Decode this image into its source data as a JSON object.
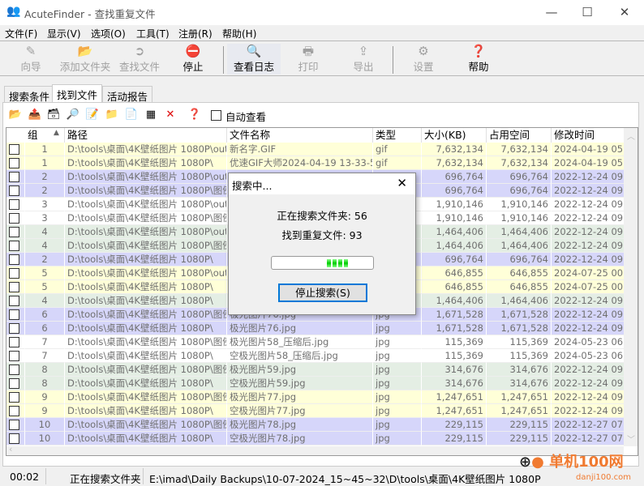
{
  "window": {
    "title": "AcuteFinder - 查找重复文件",
    "minimize": "—",
    "maximize": "☐",
    "close": "✕"
  },
  "menu": [
    "文件(F)",
    "显示(V)",
    "选项(O)",
    "工具(T)",
    "注册(R)",
    "帮助(H)"
  ],
  "toolbar": [
    {
      "label": "向导",
      "icon": "wand-icon",
      "enabled": false
    },
    {
      "label": "添加文件夹",
      "icon": "add-folder-icon",
      "enabled": false
    },
    {
      "label": "查找文件",
      "icon": "search-arrow-icon",
      "enabled": false
    },
    {
      "label": "停止",
      "icon": "stop-icon",
      "enabled": true
    },
    {
      "label": "查看日志",
      "icon": "log-icon",
      "enabled": true
    },
    {
      "label": "打印",
      "icon": "printer-icon",
      "enabled": false
    },
    {
      "label": "导出",
      "icon": "export-icon",
      "enabled": false
    },
    {
      "label": "设置",
      "icon": "settings-icon",
      "enabled": false
    },
    {
      "label": "帮助",
      "icon": "help-icon",
      "enabled": true
    }
  ],
  "tabs": [
    {
      "label": "搜索条件"
    },
    {
      "label": "找到文件",
      "active": true
    },
    {
      "label": "活动报告"
    }
  ],
  "subtoolbar": {
    "icons": [
      "open-folder-icon",
      "folder-up-icon",
      "archive-icon",
      "magnifier-icon",
      "edit-icon",
      "move-folder-icon",
      "copy-file-icon",
      "group-icon",
      "delete-icon",
      "help-icon"
    ],
    "auto_view": "自动查看"
  },
  "columns": [
    "组",
    "路径",
    "文件名称",
    "类型",
    "大小(KB)",
    "占用空间(KB)",
    "修改时间"
  ],
  "colors": {
    "yellow": "#ffffd8",
    "lavender": "#d6d6fa",
    "white": "#ffffff",
    "green": "#e4eee4"
  },
  "rows": [
    {
      "g": "1",
      "path": "D:\\tools\\桌面\\4K壁纸图片 1080P\\out...",
      "name": "新名字.GIF",
      "type": "gif",
      "size": "7,632,134",
      "space": "7,632,134",
      "mtime": "2024-04-19 05:33",
      "color": "yellow"
    },
    {
      "g": "1",
      "path": "D:\\tools\\桌面\\4K壁纸图片 1080P\\",
      "name": "优速GIF大师2024-04-19 13-33-5...",
      "type": "gif",
      "size": "7,632,134",
      "space": "7,632,134",
      "mtime": "2024-04-19 05:33",
      "color": "yellow"
    },
    {
      "g": "2",
      "path": "D:\\tools\\桌面\\4K壁纸图片 1080P\\out...",
      "name": "",
      "type": "",
      "size": "696,764",
      "space": "696,764",
      "mtime": "2022-12-24 09:53",
      "color": "lavender"
    },
    {
      "g": "2",
      "path": "D:\\tools\\桌面\\4K壁纸图片 1080P\\图例\\",
      "name": "",
      "type": "",
      "size": "696,764",
      "space": "696,764",
      "mtime": "2022-12-24 09:53",
      "color": "lavender"
    },
    {
      "g": "3",
      "path": "D:\\tools\\桌面\\4K壁纸图片 1080P\\out...",
      "name": "",
      "type": "",
      "size": "1,910,146",
      "space": "1,910,146",
      "mtime": "2022-12-24 09:53",
      "color": "white"
    },
    {
      "g": "3",
      "path": "D:\\tools\\桌面\\4K壁纸图片 1080P\\图例\\",
      "name": "",
      "type": "",
      "size": "1,910,146",
      "space": "1,910,146",
      "mtime": "2022-12-24 09:53",
      "color": "white"
    },
    {
      "g": "4",
      "path": "D:\\tools\\桌面\\4K壁纸图片 1080P\\out...",
      "name": "",
      "type": "",
      "size": "1,464,406",
      "space": "1,464,406",
      "mtime": "2022-12-24 09:52",
      "color": "green"
    },
    {
      "g": "4",
      "path": "D:\\tools\\桌面\\4K壁纸图片 1080P\\图例\\",
      "name": "",
      "type": "",
      "size": "1,464,406",
      "space": "1,464,406",
      "mtime": "2022-12-24 09:52",
      "color": "green"
    },
    {
      "g": "2",
      "path": "D:\\tools\\桌面\\4K壁纸图片 1080P\\",
      "name": "",
      "type": "",
      "size": "696,764",
      "space": "696,764",
      "mtime": "2022-12-24 09:53",
      "color": "lavender"
    },
    {
      "g": "5",
      "path": "D:\\tools\\桌面\\4K壁纸图片 1080P\\out...",
      "name": "",
      "type": "",
      "size": "646,855",
      "space": "646,855",
      "mtime": "2024-07-25 00:37",
      "color": "yellow"
    },
    {
      "g": "5",
      "path": "D:\\tools\\桌面\\4K壁纸图片 1080P\\",
      "name": "",
      "type": "",
      "size": "646,855",
      "space": "646,855",
      "mtime": "2024-07-25 00:37",
      "color": "yellow"
    },
    {
      "g": "4",
      "path": "D:\\tools\\桌面\\4K壁纸图片 1080P\\",
      "name": "",
      "type": "",
      "size": "1,464,406",
      "space": "1,464,406",
      "mtime": "2022-12-24 09:52",
      "color": "green"
    },
    {
      "g": "6",
      "path": "D:\\tools\\桌面\\4K壁纸图片 1080P\\图例\\",
      "name": "极光图片76.jpg",
      "type": "jpg",
      "size": "1,671,528",
      "space": "1,671,528",
      "mtime": "2022-12-24 09:53",
      "color": "lavender"
    },
    {
      "g": "6",
      "path": "D:\\tools\\桌面\\4K壁纸图片 1080P\\",
      "name": "极光图片76.jpg",
      "type": "jpg",
      "size": "1,671,528",
      "space": "1,671,528",
      "mtime": "2022-12-24 09:53",
      "color": "lavender"
    },
    {
      "g": "7",
      "path": "D:\\tools\\桌面\\4K壁纸图片 1080P\\图例\\",
      "name": "极光图片58_压缩后.jpg",
      "type": "jpg",
      "size": "115,369",
      "space": "115,369",
      "mtime": "2024-05-23 06:45",
      "color": "white"
    },
    {
      "g": "7",
      "path": "D:\\tools\\桌面\\4K壁纸图片 1080P\\",
      "name": "空极光图片58_压缩后.jpg",
      "type": "jpg",
      "size": "115,369",
      "space": "115,369",
      "mtime": "2024-05-23 06:45",
      "color": "white"
    },
    {
      "g": "8",
      "path": "D:\\tools\\桌面\\4K壁纸图片 1080P\\图例\\",
      "name": "极光图片59.jpg",
      "type": "jpg",
      "size": "314,676",
      "space": "314,676",
      "mtime": "2022-12-24 09:52",
      "color": "green"
    },
    {
      "g": "8",
      "path": "D:\\tools\\桌面\\4K壁纸图片 1080P\\",
      "name": "空极光图片59.jpg",
      "type": "jpg",
      "size": "314,676",
      "space": "314,676",
      "mtime": "2022-12-24 09:52",
      "color": "green"
    },
    {
      "g": "9",
      "path": "D:\\tools\\桌面\\4K壁纸图片 1080P\\图例\\",
      "name": "极光图片77.jpg",
      "type": "jpg",
      "size": "1,247,651",
      "space": "1,247,651",
      "mtime": "2022-12-24 09:53",
      "color": "yellow"
    },
    {
      "g": "9",
      "path": "D:\\tools\\桌面\\4K壁纸图片 1080P\\",
      "name": "空极光图片77.jpg",
      "type": "jpg",
      "size": "1,247,651",
      "space": "1,247,651",
      "mtime": "2022-12-24 09:53",
      "color": "yellow"
    },
    {
      "g": "10",
      "path": "D:\\tools\\桌面\\4K壁纸图片 1080P\\图例\\",
      "name": "极光图片78.jpg",
      "type": "jpg",
      "size": "229,115",
      "space": "229,115",
      "mtime": "2022-12-27 07:23",
      "color": "lavender"
    },
    {
      "g": "10",
      "path": "D:\\tools\\桌面\\4K壁纸图片 1080P\\",
      "name": "空极光图片78.jpg",
      "type": "jpg",
      "size": "229,115",
      "space": "229,115",
      "mtime": "2022-12-27 07:23",
      "color": "lavender"
    }
  ],
  "dialog": {
    "title": "搜索中...",
    "close": "✕",
    "folders_label": "正在搜索文件夹: 56",
    "found_label": "找到重复文件: 93",
    "stop_button": "停止搜索(S)"
  },
  "status": {
    "time": "00:02",
    "state": "正在搜索文件夹",
    "path": "E:\\imad\\Daily Backups\\10-07-2024_15~45~32\\D\\tools\\桌面\\4K壁纸图片 1080P"
  },
  "watermark": {
    "text": "单机100网",
    "url": "danji100.com"
  }
}
